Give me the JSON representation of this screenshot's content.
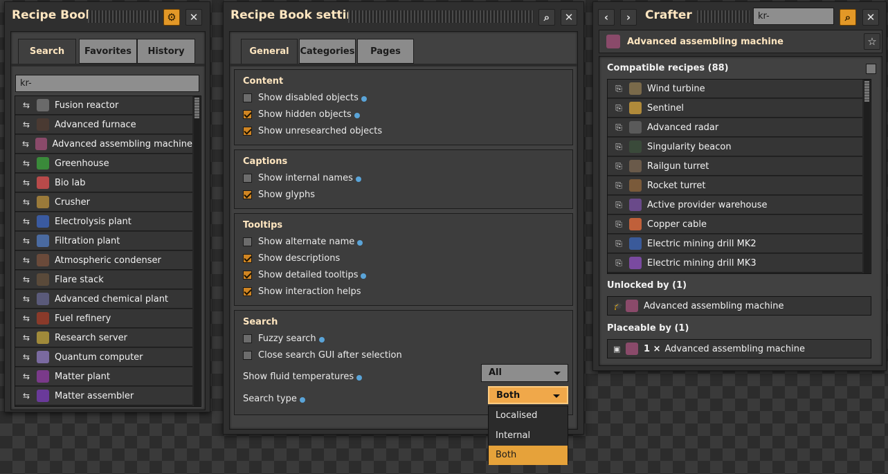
{
  "colors": {
    "accent": "#e39827",
    "panel": "#2f2f2f",
    "title_text": "#ffe6c0",
    "checkbox_on": "#d08522",
    "info_dot": "#5aa4d8"
  },
  "recipe_book": {
    "title": "Recipe Book",
    "tabs": [
      "Search",
      "Favorites",
      "History"
    ],
    "search_value": "kr-",
    "items": [
      {
        "label": "Fusion reactor",
        "icon": "fusion-reactor-icon",
        "color": "#6a6a6a"
      },
      {
        "label": "Advanced furnace",
        "icon": "advanced-furnace-icon",
        "color": "#4a3a32"
      },
      {
        "label": "Advanced assembling machine",
        "icon": "advanced-assembler-icon",
        "color": "#8a4a6a"
      },
      {
        "label": "Greenhouse",
        "icon": "greenhouse-icon",
        "color": "#3a8a3a"
      },
      {
        "label": "Bio lab",
        "icon": "bio-lab-icon",
        "color": "#b84a4a"
      },
      {
        "label": "Crusher",
        "icon": "crusher-icon",
        "color": "#9a7a3a"
      },
      {
        "label": "Electrolysis plant",
        "icon": "electrolysis-plant-icon",
        "color": "#3a5aa0"
      },
      {
        "label": "Filtration plant",
        "icon": "filtration-plant-icon",
        "color": "#4a6aa0"
      },
      {
        "label": "Atmospheric condenser",
        "icon": "atmospheric-condenser-icon",
        "color": "#6a4a3a"
      },
      {
        "label": "Flare stack",
        "icon": "flare-stack-icon",
        "color": "#5a4a3a"
      },
      {
        "label": "Advanced chemical plant",
        "icon": "advanced-chemical-plant-icon",
        "color": "#5a5a7a"
      },
      {
        "label": "Fuel refinery",
        "icon": "fuel-refinery-icon",
        "color": "#8a3a2a"
      },
      {
        "label": "Research server",
        "icon": "research-server-icon",
        "color": "#a08a3a"
      },
      {
        "label": "Quantum computer",
        "icon": "quantum-computer-icon",
        "color": "#7a6aa0"
      },
      {
        "label": "Matter plant",
        "icon": "matter-plant-icon",
        "color": "#7a3a8a"
      },
      {
        "label": "Matter assembler",
        "icon": "matter-assembler-icon",
        "color": "#6a3a9a"
      }
    ]
  },
  "settings": {
    "title": "Recipe Book settings",
    "tabs": [
      "General",
      "Categories",
      "Pages"
    ],
    "content": {
      "header": "Content",
      "options": [
        {
          "label": "Show disabled objects",
          "checked": false,
          "info": true
        },
        {
          "label": "Show hidden objects",
          "checked": true,
          "info": true
        },
        {
          "label": "Show unresearched objects",
          "checked": true,
          "info": false
        }
      ]
    },
    "captions": {
      "header": "Captions",
      "options": [
        {
          "label": "Show internal names",
          "checked": false,
          "info": true
        },
        {
          "label": "Show glyphs",
          "checked": true,
          "info": false
        }
      ]
    },
    "tooltips": {
      "header": "Tooltips",
      "options": [
        {
          "label": "Show alternate name",
          "checked": false,
          "info": true
        },
        {
          "label": "Show descriptions",
          "checked": true,
          "info": false
        },
        {
          "label": "Show detailed tooltips",
          "checked": true,
          "info": true
        },
        {
          "label": "Show interaction helps",
          "checked": true,
          "info": false
        }
      ]
    },
    "search": {
      "header": "Search",
      "options": [
        {
          "label": "Fuzzy search",
          "checked": false,
          "info": true
        },
        {
          "label": "Close search GUI after selection",
          "checked": false,
          "info": false
        }
      ],
      "fluid_label": "Show fluid temperatures",
      "fluid_value": "All",
      "type_label": "Search type",
      "type_value": "Both",
      "type_options": [
        "Localised",
        "Internal",
        "Both"
      ],
      "type_selected_index": 2
    }
  },
  "crafter": {
    "title": "Crafter",
    "search_value": "kr-",
    "entity_name": "Advanced assembling machine",
    "compatible_header": "Compatible recipes (88)",
    "recipes": [
      {
        "label": "Wind turbine",
        "icon": "wind-turbine-icon",
        "color": "#7a6a4a"
      },
      {
        "label": "Sentinel",
        "icon": "sentinel-icon",
        "color": "#b08a3a"
      },
      {
        "label": "Advanced radar",
        "icon": "advanced-radar-icon",
        "color": "#5a5a5a"
      },
      {
        "label": "Singularity beacon",
        "icon": "singularity-beacon-icon",
        "color": "#3a4a3a"
      },
      {
        "label": "Railgun turret",
        "icon": "railgun-turret-icon",
        "color": "#6a5a4a"
      },
      {
        "label": "Rocket turret",
        "icon": "rocket-turret-icon",
        "color": "#7a5a3a"
      },
      {
        "label": "Active provider warehouse",
        "icon": "active-provider-warehouse-icon",
        "color": "#6a4a8a"
      },
      {
        "label": "Copper cable",
        "icon": "copper-cable-icon",
        "color": "#c0603a"
      },
      {
        "label": "Electric mining drill MK2",
        "icon": "mining-drill-mk2-icon",
        "color": "#3a5a9a"
      },
      {
        "label": "Electric mining drill MK3",
        "icon": "mining-drill-mk3-icon",
        "color": "#7a4aa0"
      }
    ],
    "unlocked_header": "Unlocked by (1)",
    "unlocked_item": "Advanced assembling machine",
    "placeable_header": "Placeable by (1)",
    "placeable_count": "1 ×",
    "placeable_item": "Advanced assembling machine"
  }
}
